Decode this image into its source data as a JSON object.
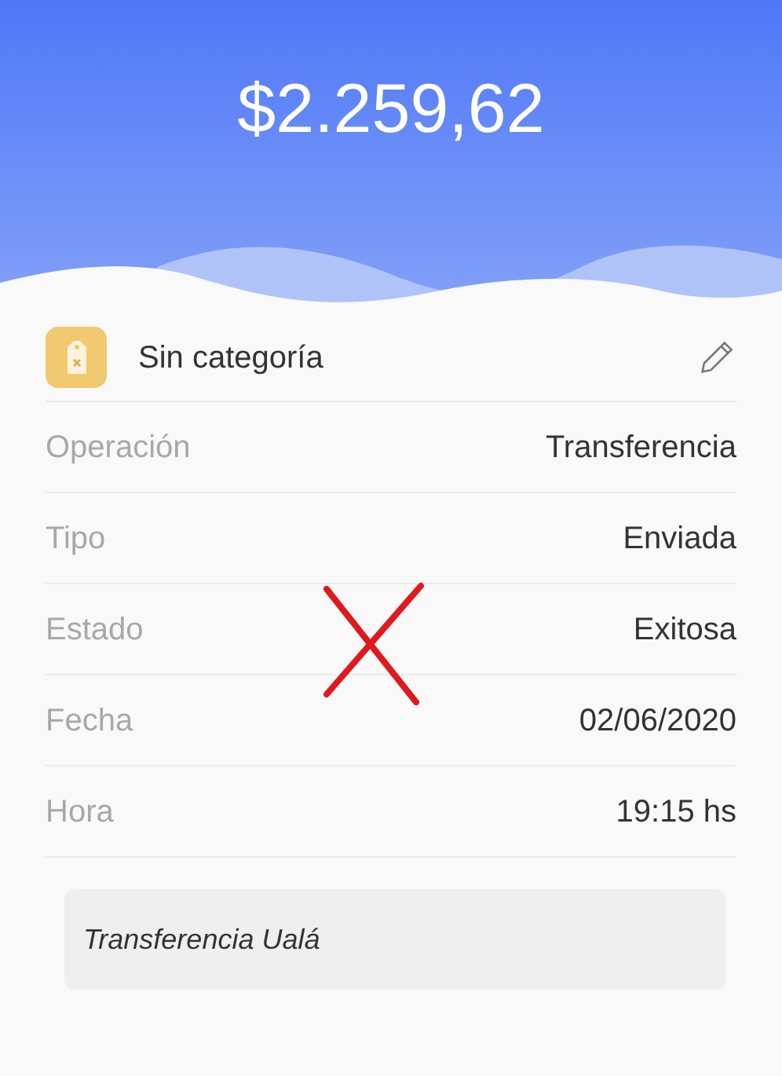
{
  "amount": "$2.259,62",
  "category": {
    "label": "Sin categoría"
  },
  "details": [
    {
      "label": "Operación",
      "value": "Transferencia"
    },
    {
      "label": "Tipo",
      "value": "Enviada"
    },
    {
      "label": "Estado",
      "value": "Exitosa"
    },
    {
      "label": "Fecha",
      "value": "02/06/2020"
    },
    {
      "label": "Hora",
      "value": "19:15 hs"
    }
  ],
  "note": "Transferencia Ualá"
}
